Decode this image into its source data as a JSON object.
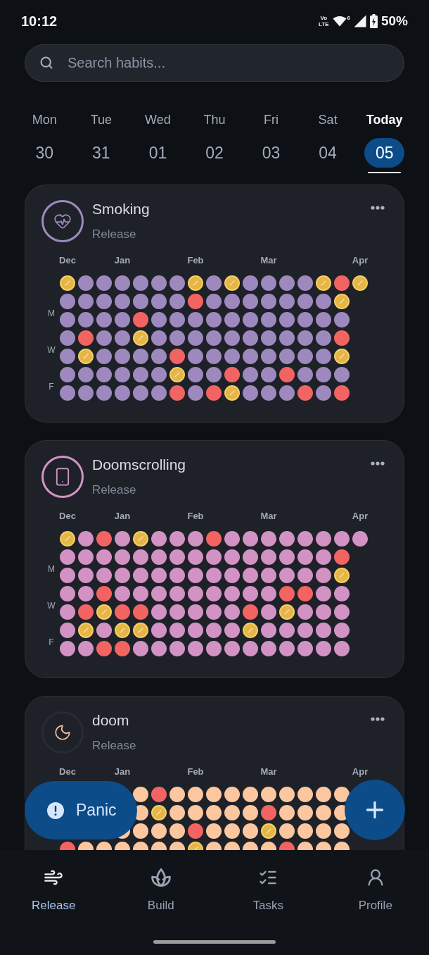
{
  "status_bar": {
    "time": "10:12",
    "network": [
      "Vo",
      "LTE"
    ],
    "wifi_badge": "6",
    "battery": "50%"
  },
  "search": {
    "placeholder": "Search habits..."
  },
  "days": [
    {
      "weekday": "Mon",
      "date": "30",
      "selected": false
    },
    {
      "weekday": "Tue",
      "date": "31",
      "selected": false
    },
    {
      "weekday": "Wed",
      "date": "01",
      "selected": false
    },
    {
      "weekday": "Thu",
      "date": "02",
      "selected": false
    },
    {
      "weekday": "Fri",
      "date": "03",
      "selected": false
    },
    {
      "weekday": "Sat",
      "date": "04",
      "selected": false
    },
    {
      "weekday": "Today",
      "date": "05",
      "selected": true
    }
  ],
  "habits": [
    {
      "name": "Smoking",
      "category": "Release",
      "color": "#9e89bf",
      "kind": "heart",
      "highlighted": true,
      "weekday_labels": [
        "M",
        "W",
        "F"
      ],
      "weeks": [
        {
          "month": "Dec",
          "days": [
            {
              "kind": "milestone"
            },
            {
              "kind": "clean"
            },
            {
              "kind": "clean"
            },
            {
              "kind": "clean"
            },
            {
              "kind": "clean"
            },
            {
              "kind": "clean"
            },
            {
              "kind": "clean"
            }
          ]
        },
        {
          "days": [
            {
              "kind": "clean"
            },
            {
              "kind": "clean"
            },
            {
              "kind": "clean"
            },
            {
              "kind": "relapse"
            },
            {
              "kind": "milestone"
            },
            {
              "kind": "clean"
            },
            {
              "kind": "clean"
            }
          ]
        },
        {
          "days": [
            {
              "kind": "clean"
            },
            {
              "kind": "clean"
            },
            {
              "kind": "clean"
            },
            {
              "kind": "clean"
            },
            {
              "kind": "clean"
            },
            {
              "kind": "clean"
            },
            {
              "kind": "clean"
            }
          ]
        },
        {
          "month": "Jan",
          "days": [
            {
              "kind": "clean"
            },
            {
              "kind": "clean"
            },
            {
              "kind": "clean"
            },
            {
              "kind": "clean"
            },
            {
              "kind": "clean"
            },
            {
              "kind": "clean"
            },
            {
              "kind": "clean"
            }
          ]
        },
        {
          "days": [
            {
              "kind": "clean"
            },
            {
              "kind": "clean"
            },
            {
              "kind": "relapse"
            },
            {
              "kind": "milestone"
            },
            {
              "kind": "clean"
            },
            {
              "kind": "clean"
            },
            {
              "kind": "clean"
            }
          ]
        },
        {
          "days": [
            {
              "kind": "clean"
            },
            {
              "kind": "clean"
            },
            {
              "kind": "clean"
            },
            {
              "kind": "clean"
            },
            {
              "kind": "clean"
            },
            {
              "kind": "clean"
            },
            {
              "kind": "clean"
            }
          ]
        },
        {
          "days": [
            {
              "kind": "clean"
            },
            {
              "kind": "clean"
            },
            {
              "kind": "clean"
            },
            {
              "kind": "clean"
            },
            {
              "kind": "relapse"
            },
            {
              "kind": "milestone"
            },
            {
              "kind": "relapse"
            }
          ]
        },
        {
          "month": "Feb",
          "days": [
            {
              "kind": "milestone"
            },
            {
              "kind": "relapse"
            },
            {
              "kind": "clean"
            },
            {
              "kind": "clean"
            },
            {
              "kind": "clean"
            },
            {
              "kind": "clean"
            },
            {
              "kind": "clean"
            }
          ]
        },
        {
          "days": [
            {
              "kind": "clean"
            },
            {
              "kind": "clean"
            },
            {
              "kind": "clean"
            },
            {
              "kind": "clean"
            },
            {
              "kind": "clean"
            },
            {
              "kind": "clean"
            },
            {
              "kind": "relapse"
            }
          ]
        },
        {
          "days": [
            {
              "kind": "milestone"
            },
            {
              "kind": "clean"
            },
            {
              "kind": "clean"
            },
            {
              "kind": "clean"
            },
            {
              "kind": "clean"
            },
            {
              "kind": "relapse"
            },
            {
              "kind": "milestone"
            }
          ]
        },
        {
          "days": [
            {
              "kind": "clean"
            },
            {
              "kind": "clean"
            },
            {
              "kind": "clean"
            },
            {
              "kind": "clean"
            },
            {
              "kind": "clean"
            },
            {
              "kind": "clean"
            },
            {
              "kind": "clean"
            }
          ]
        },
        {
          "month": "Mar",
          "days": [
            {
              "kind": "clean"
            },
            {
              "kind": "clean"
            },
            {
              "kind": "clean"
            },
            {
              "kind": "clean"
            },
            {
              "kind": "clean"
            },
            {
              "kind": "clean"
            },
            {
              "kind": "clean"
            }
          ]
        },
        {
          "days": [
            {
              "kind": "clean"
            },
            {
              "kind": "clean"
            },
            {
              "kind": "clean"
            },
            {
              "kind": "clean"
            },
            {
              "kind": "clean"
            },
            {
              "kind": "relapse"
            },
            {
              "kind": "clean"
            }
          ]
        },
        {
          "days": [
            {
              "kind": "clean"
            },
            {
              "kind": "clean"
            },
            {
              "kind": "clean"
            },
            {
              "kind": "clean"
            },
            {
              "kind": "clean"
            },
            {
              "kind": "clean"
            },
            {
              "kind": "relapse"
            }
          ]
        },
        {
          "days": [
            {
              "kind": "milestone"
            },
            {
              "kind": "clean"
            },
            {
              "kind": "clean"
            },
            {
              "kind": "clean"
            },
            {
              "kind": "clean"
            },
            {
              "kind": "clean"
            },
            {
              "kind": "clean"
            }
          ]
        },
        {
          "days": [
            {
              "kind": "relapse"
            },
            {
              "kind": "milestone"
            },
            {
              "kind": "clean"
            },
            {
              "kind": "relapse"
            },
            {
              "kind": "milestone"
            },
            {
              "kind": "clean"
            },
            {
              "kind": "relapse"
            }
          ]
        },
        {
          "month": "Apr",
          "days": [
            {
              "kind": "milestone"
            }
          ]
        }
      ]
    },
    {
      "name": "Doomscrolling",
      "category": "Release",
      "color": "#d392c4",
      "kind": "phone",
      "highlighted": true,
      "weekday_labels": [
        "M",
        "W",
        "F"
      ],
      "weeks": [
        {
          "month": "Dec",
          "days": [
            {
              "kind": "milestone"
            },
            {
              "kind": "clean"
            },
            {
              "kind": "clean"
            },
            {
              "kind": "clean"
            },
            {
              "kind": "clean"
            },
            {
              "kind": "clean"
            },
            {
              "kind": "clean"
            }
          ]
        },
        {
          "days": [
            {
              "kind": "clean"
            },
            {
              "kind": "clean"
            },
            {
              "kind": "clean"
            },
            {
              "kind": "clean"
            },
            {
              "kind": "relapse"
            },
            {
              "kind": "milestone"
            },
            {
              "kind": "clean"
            }
          ]
        },
        {
          "days": [
            {
              "kind": "relapse"
            },
            {
              "kind": "clean"
            },
            {
              "kind": "clean"
            },
            {
              "kind": "relapse"
            },
            {
              "kind": "milestone"
            },
            {
              "kind": "clean"
            },
            {
              "kind": "relapse"
            }
          ]
        },
        {
          "month": "Jan",
          "days": [
            {
              "kind": "clean"
            },
            {
              "kind": "clean"
            },
            {
              "kind": "clean"
            },
            {
              "kind": "clean"
            },
            {
              "kind": "relapse"
            },
            {
              "kind": "milestone"
            },
            {
              "kind": "relapse"
            }
          ]
        },
        {
          "days": [
            {
              "kind": "milestone"
            },
            {
              "kind": "clean"
            },
            {
              "kind": "clean"
            },
            {
              "kind": "clean"
            },
            {
              "kind": "relapse"
            },
            {
              "kind": "milestone"
            },
            {
              "kind": "clean"
            }
          ]
        },
        {
          "days": [
            {
              "kind": "clean"
            },
            {
              "kind": "clean"
            },
            {
              "kind": "clean"
            },
            {
              "kind": "clean"
            },
            {
              "kind": "clean"
            },
            {
              "kind": "clean"
            },
            {
              "kind": "clean"
            }
          ]
        },
        {
          "days": [
            {
              "kind": "clean"
            },
            {
              "kind": "clean"
            },
            {
              "kind": "clean"
            },
            {
              "kind": "clean"
            },
            {
              "kind": "clean"
            },
            {
              "kind": "clean"
            },
            {
              "kind": "clean"
            }
          ]
        },
        {
          "month": "Feb",
          "days": [
            {
              "kind": "clean"
            },
            {
              "kind": "clean"
            },
            {
              "kind": "clean"
            },
            {
              "kind": "clean"
            },
            {
              "kind": "clean"
            },
            {
              "kind": "clean"
            },
            {
              "kind": "clean"
            }
          ]
        },
        {
          "days": [
            {
              "kind": "relapse"
            },
            {
              "kind": "clean"
            },
            {
              "kind": "clean"
            },
            {
              "kind": "clean"
            },
            {
              "kind": "clean"
            },
            {
              "kind": "clean"
            },
            {
              "kind": "clean"
            }
          ]
        },
        {
          "days": [
            {
              "kind": "clean"
            },
            {
              "kind": "clean"
            },
            {
              "kind": "clean"
            },
            {
              "kind": "clean"
            },
            {
              "kind": "clean"
            },
            {
              "kind": "clean"
            },
            {
              "kind": "clean"
            }
          ]
        },
        {
          "days": [
            {
              "kind": "clean"
            },
            {
              "kind": "clean"
            },
            {
              "kind": "clean"
            },
            {
              "kind": "clean"
            },
            {
              "kind": "relapse"
            },
            {
              "kind": "milestone"
            },
            {
              "kind": "clean"
            }
          ]
        },
        {
          "month": "Mar",
          "days": [
            {
              "kind": "clean"
            },
            {
              "kind": "clean"
            },
            {
              "kind": "clean"
            },
            {
              "kind": "clean"
            },
            {
              "kind": "clean"
            },
            {
              "kind": "clean"
            },
            {
              "kind": "clean"
            }
          ]
        },
        {
          "days": [
            {
              "kind": "clean"
            },
            {
              "kind": "clean"
            },
            {
              "kind": "clean"
            },
            {
              "kind": "relapse"
            },
            {
              "kind": "milestone"
            },
            {
              "kind": "clean"
            },
            {
              "kind": "clean"
            }
          ]
        },
        {
          "days": [
            {
              "kind": "clean"
            },
            {
              "kind": "clean"
            },
            {
              "kind": "clean"
            },
            {
              "kind": "relapse"
            },
            {
              "kind": "clean"
            },
            {
              "kind": "clean"
            },
            {
              "kind": "clean"
            }
          ]
        },
        {
          "days": [
            {
              "kind": "clean"
            },
            {
              "kind": "clean"
            },
            {
              "kind": "clean"
            },
            {
              "kind": "clean"
            },
            {
              "kind": "clean"
            },
            {
              "kind": "clean"
            },
            {
              "kind": "clean"
            }
          ]
        },
        {
          "days": [
            {
              "kind": "clean"
            },
            {
              "kind": "relapse"
            },
            {
              "kind": "milestone"
            },
            {
              "kind": "clean"
            },
            {
              "kind": "clean"
            },
            {
              "kind": "clean"
            },
            {
              "kind": "clean"
            }
          ]
        },
        {
          "month": "Apr",
          "days": [
            {
              "kind": "clean"
            }
          ]
        }
      ]
    },
    {
      "name": "doom",
      "category": "Release",
      "color": "#fcc69f",
      "kind": "moon",
      "highlighted": false,
      "weeks": [
        {
          "month": "Dec",
          "days": [
            {
              "kind": "covered"
            },
            {
              "kind": "covered"
            },
            {
              "kind": "covered"
            },
            {
              "kind": "relapse"
            }
          ]
        },
        {
          "days": [
            {
              "kind": "covered"
            },
            {
              "kind": "covered"
            },
            {
              "kind": "covered"
            },
            {
              "kind": "clean"
            }
          ]
        },
        {
          "days": [
            {
              "kind": "covered"
            },
            {
              "kind": "covered"
            },
            {
              "kind": "covered"
            },
            {
              "kind": "clean"
            }
          ]
        },
        {
          "month": "Jan",
          "days": [
            {
              "kind": "covered"
            },
            {
              "kind": "covered"
            },
            {
              "kind": "clean"
            },
            {
              "kind": "clean"
            }
          ]
        },
        {
          "days": [
            {
              "kind": "clean"
            },
            {
              "kind": "clean"
            },
            {
              "kind": "clean"
            },
            {
              "kind": "clean"
            }
          ]
        },
        {
          "days": [
            {
              "kind": "relapse"
            },
            {
              "kind": "milestone"
            },
            {
              "kind": "clean"
            },
            {
              "kind": "clean"
            }
          ]
        },
        {
          "days": [
            {
              "kind": "clean"
            },
            {
              "kind": "clean"
            },
            {
              "kind": "clean"
            },
            {
              "kind": "clean"
            }
          ]
        },
        {
          "month": "Feb",
          "days": [
            {
              "kind": "clean"
            },
            {
              "kind": "clean"
            },
            {
              "kind": "relapse"
            },
            {
              "kind": "milestone"
            }
          ]
        },
        {
          "days": [
            {
              "kind": "clean"
            },
            {
              "kind": "clean"
            },
            {
              "kind": "clean"
            },
            {
              "kind": "clean"
            }
          ]
        },
        {
          "days": [
            {
              "kind": "clean"
            },
            {
              "kind": "clean"
            },
            {
              "kind": "clean"
            },
            {
              "kind": "clean"
            }
          ]
        },
        {
          "days": [
            {
              "kind": "clean"
            },
            {
              "kind": "clean"
            },
            {
              "kind": "clean"
            },
            {
              "kind": "clean"
            }
          ]
        },
        {
          "month": "Mar",
          "days": [
            {
              "kind": "clean"
            },
            {
              "kind": "relapse"
            },
            {
              "kind": "milestone"
            },
            {
              "kind": "clean"
            }
          ]
        },
        {
          "days": [
            {
              "kind": "clean"
            },
            {
              "kind": "clean"
            },
            {
              "kind": "clean"
            },
            {
              "kind": "relapse"
            }
          ]
        },
        {
          "days": [
            {
              "kind": "clean"
            },
            {
              "kind": "clean"
            },
            {
              "kind": "clean"
            },
            {
              "kind": "clean"
            }
          ]
        },
        {
          "days": [
            {
              "kind": "clean"
            },
            {
              "kind": "clean"
            },
            {
              "kind": "clean"
            },
            {
              "kind": "clean"
            }
          ]
        },
        {
          "days": [
            {
              "kind": "clean"
            },
            {
              "kind": "clean"
            },
            {
              "kind": "clean"
            },
            {
              "kind": "clean"
            }
          ]
        },
        {
          "month": "Apr"
        }
      ]
    }
  ],
  "panic_button": {
    "label": "Panic"
  },
  "nav": [
    {
      "label": "Release",
      "kind": "wind",
      "selected": true
    },
    {
      "label": "Build",
      "kind": "lotus",
      "selected": false
    },
    {
      "label": "Tasks",
      "kind": "checklist",
      "selected": false
    },
    {
      "label": "Profile",
      "kind": "person",
      "selected": false
    }
  ]
}
